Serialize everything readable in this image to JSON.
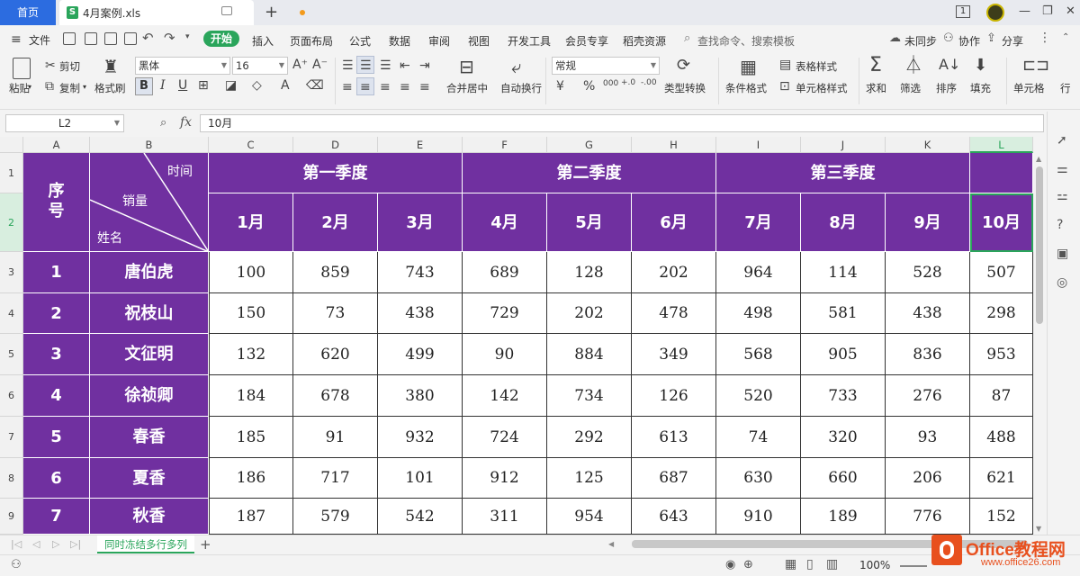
{
  "titlebar": {
    "home_tab": "首页",
    "doc_tab": "4月案例.xls",
    "file_icon_letter": "S",
    "page_indicator": "1"
  },
  "menu": {
    "file": "文件",
    "tabs": [
      "开始",
      "插入",
      "页面布局",
      "公式",
      "数据",
      "审阅",
      "视图",
      "开发工具",
      "会员专享",
      "稻壳资源"
    ],
    "search_placeholder": "查找命令、搜索模板",
    "sync": "未同步",
    "collab": "协作",
    "share": "分享"
  },
  "ribbon": {
    "paste": "粘贴",
    "cut": "剪切",
    "copy": "复制",
    "format_painter": "格式刷",
    "font_name": "黑体",
    "font_size": "16",
    "merge_center": "合并居中",
    "wrap_text": "自动换行",
    "number_format": "常规",
    "type_convert": "类型转换",
    "cond_format": "条件格式",
    "table_style": "表格样式",
    "cell_style": "单元格样式",
    "sum": "求和",
    "filter": "筛选",
    "sort": "排序",
    "fill": "填充",
    "cell": "单元格",
    "row_col": "行"
  },
  "formula_bar": {
    "cell_ref": "L2",
    "fx": "fx",
    "value": "10月"
  },
  "columns": [
    "A",
    "B",
    "C",
    "D",
    "E",
    "F",
    "G",
    "H",
    "I",
    "J",
    "K",
    "L"
  ],
  "active_column": "L",
  "active_row": "2",
  "rows": [
    "1",
    "2",
    "3",
    "4",
    "5",
    "6",
    "7",
    "8",
    "9"
  ],
  "table": {
    "seq_header": "序号",
    "diag_time": "时间",
    "diag_sales": "销量",
    "diag_name": "姓名",
    "quarters": [
      "第一季度",
      "第二季度",
      "第三季度"
    ],
    "months": [
      "1月",
      "2月",
      "3月",
      "4月",
      "5月",
      "6月",
      "7月",
      "8月",
      "9月",
      "10月"
    ],
    "records": [
      {
        "seq": "1",
        "name": "唐伯虎",
        "values": [
          "100",
          "859",
          "743",
          "689",
          "128",
          "202",
          "964",
          "114",
          "528",
          "507"
        ]
      },
      {
        "seq": "2",
        "name": "祝枝山",
        "values": [
          "150",
          "73",
          "438",
          "729",
          "202",
          "478",
          "498",
          "581",
          "438",
          "298"
        ]
      },
      {
        "seq": "3",
        "name": "文征明",
        "values": [
          "132",
          "620",
          "499",
          "90",
          "884",
          "349",
          "568",
          "905",
          "836",
          "953"
        ]
      },
      {
        "seq": "4",
        "name": "徐祯卿",
        "values": [
          "184",
          "678",
          "380",
          "142",
          "734",
          "126",
          "520",
          "733",
          "276",
          "87"
        ]
      },
      {
        "seq": "5",
        "name": "春香",
        "values": [
          "185",
          "91",
          "932",
          "724",
          "292",
          "613",
          "74",
          "320",
          "93",
          "488"
        ]
      },
      {
        "seq": "6",
        "name": "夏香",
        "values": [
          "186",
          "717",
          "101",
          "912",
          "125",
          "687",
          "630",
          "660",
          "206",
          "621"
        ]
      },
      {
        "seq": "7",
        "name": "秋香",
        "values": [
          "187",
          "579",
          "542",
          "311",
          "954",
          "643",
          "910",
          "189",
          "776",
          "152"
        ]
      }
    ]
  },
  "sheet_tab": "同时冻结多行多列",
  "status": {
    "zoom": "100%"
  },
  "watermark": {
    "brand": "Office教程网",
    "url": "www.office26.com"
  },
  "colors": {
    "purple": "#7030a0",
    "accent_green": "#2aa55b",
    "home_blue": "#2c6ce0"
  }
}
